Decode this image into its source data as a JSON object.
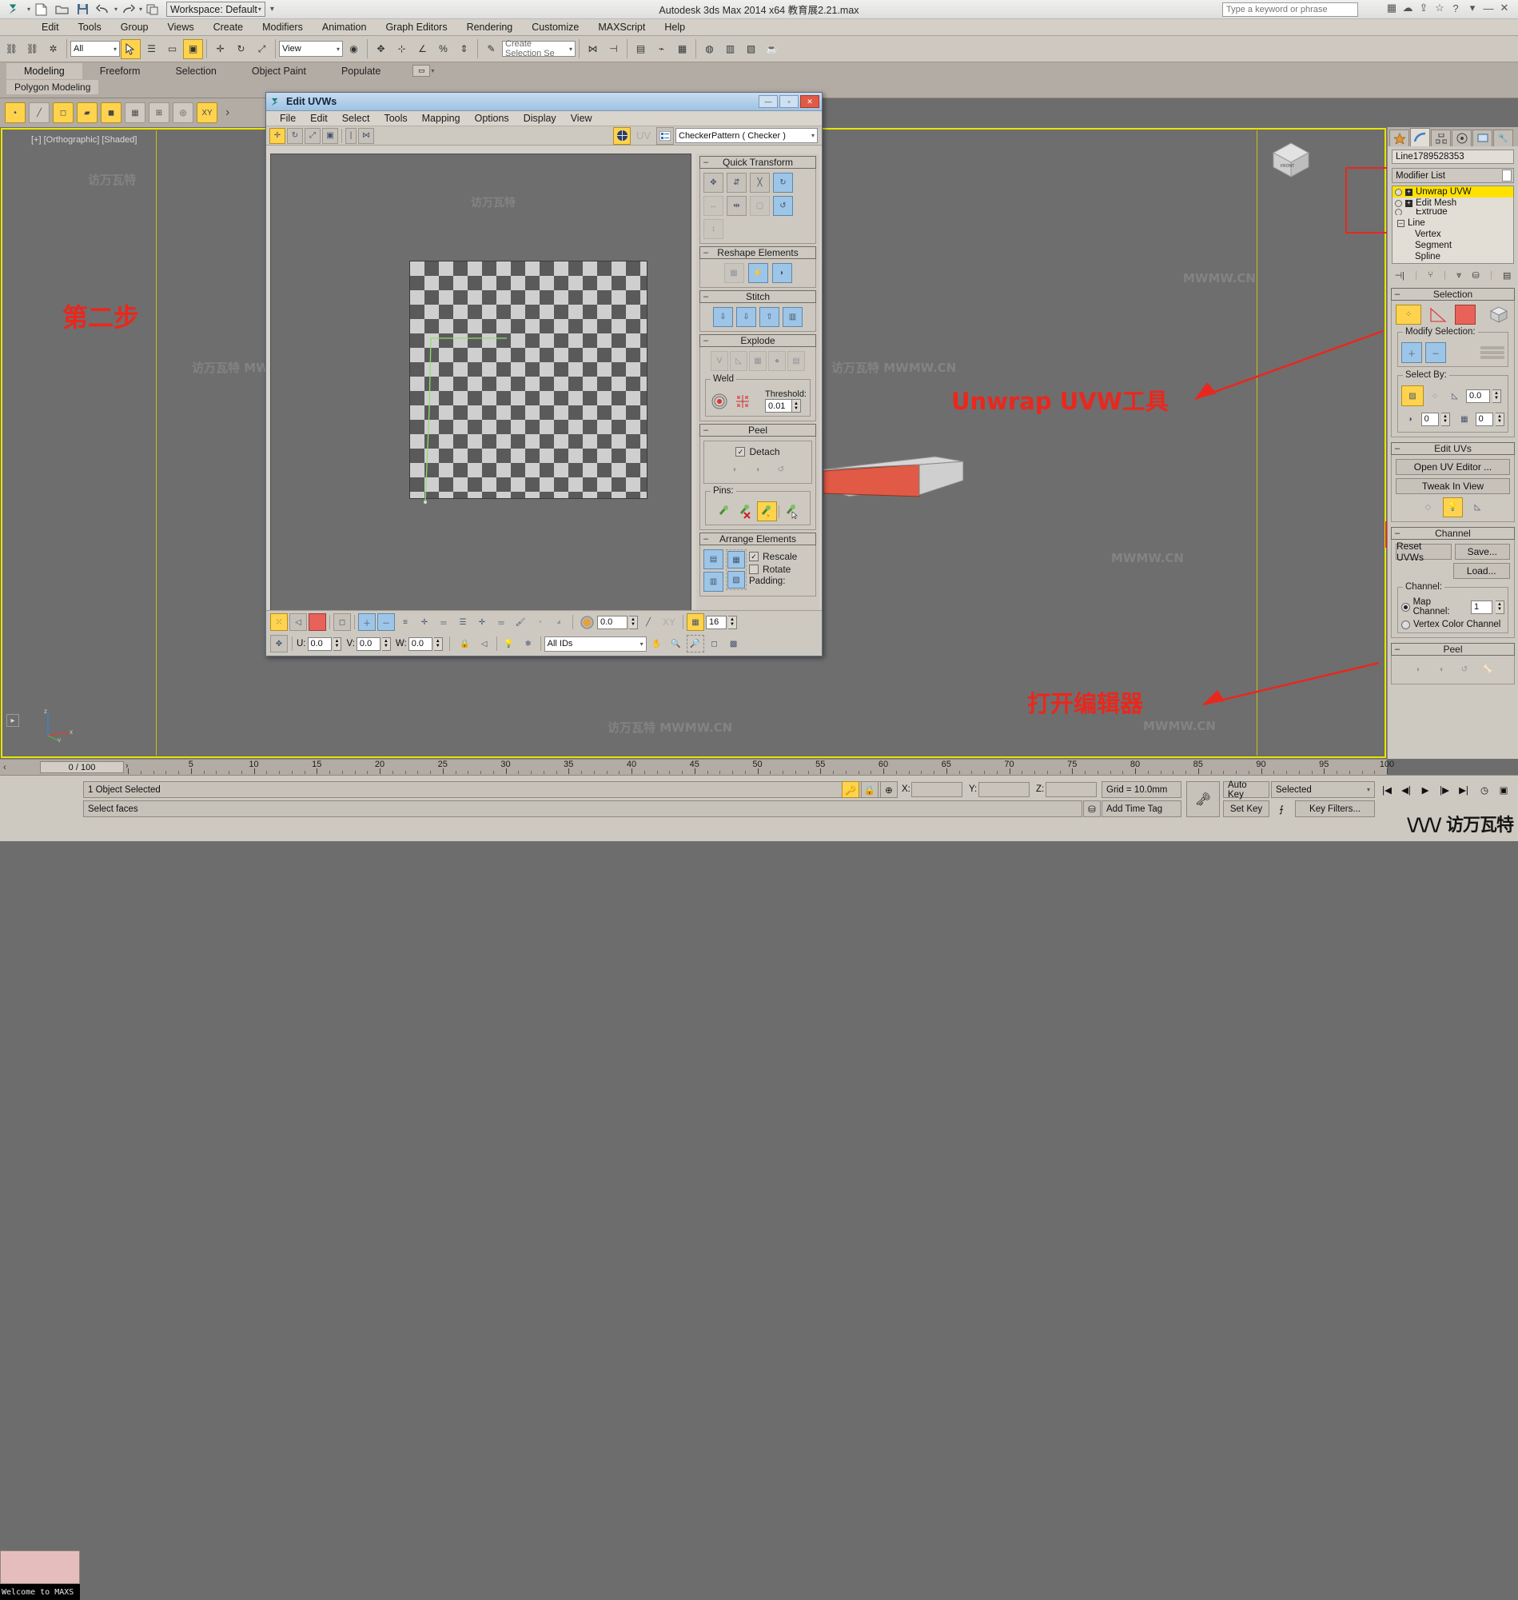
{
  "titlebar": {
    "app_title": "Autodesk 3ds Max  2014 x64      教育展2.21.max",
    "workspace_label": "Workspace: Default",
    "search_placeholder": "Type a keyword or phrase",
    "icons": [
      "new-file-icon",
      "open-file-icon",
      "save-icon",
      "undo-icon",
      "redo-icon",
      "project-folder-icon"
    ],
    "window_buttons": [
      "minimize",
      "restore",
      "close"
    ]
  },
  "menubar": {
    "items": [
      "Edit",
      "Tools",
      "Group",
      "Views",
      "Create",
      "Modifiers",
      "Animation",
      "Graph Editors",
      "Rendering",
      "Customize",
      "MAXScript",
      "Help"
    ]
  },
  "maintoolbar": {
    "selection_filter": "All",
    "reference_coord": "View",
    "named_selection_set": "Create Selection Se"
  },
  "ribbon": {
    "tabs": [
      "Modeling",
      "Freeform",
      "Selection",
      "Object Paint",
      "Populate"
    ],
    "active_tab": "Modeling",
    "subtab": "Polygon Modeling"
  },
  "viewport": {
    "label": "[+] [Orthographic] [Shaded]",
    "annotations": [
      {
        "text": "第二步",
        "id": "step-two"
      },
      {
        "text": "Unwrap UVW工具",
        "id": "unwrap-uvw-tool"
      },
      {
        "text": "打开编辑器",
        "id": "open-editor"
      }
    ],
    "watermarks": [
      "MWMW.CN",
      "MWMW.CN",
      "MWMW.CN",
      "MWMW.CN",
      "MWMW.CN",
      "MWMW.CN"
    ],
    "viewcube_label": "FRONT"
  },
  "uvw_dialog": {
    "title": "Edit UVWs",
    "menu": [
      "File",
      "Edit",
      "Select",
      "Tools",
      "Mapping",
      "Options",
      "Display",
      "View"
    ],
    "map_dropdown": "CheckerPattern  ( Checker )",
    "rollouts": [
      {
        "name": "Quick Transform",
        "collapsed": false
      },
      {
        "name": "Reshape Elements",
        "collapsed": false
      },
      {
        "name": "Stitch",
        "collapsed": false
      },
      {
        "name": "Explode",
        "collapsed": false
      },
      {
        "name": "Peel",
        "collapsed": false
      },
      {
        "name": "Arrange Elements",
        "collapsed": false
      }
    ],
    "weld": {
      "group_label": "Weld",
      "threshold_label": "Threshold:",
      "threshold_value": "0.01"
    },
    "peel": {
      "detach_label": "Detach",
      "detach_checked": true,
      "pins_label": "Pins:"
    },
    "arrange": {
      "rescale_label": "Rescale",
      "rescale_checked": true,
      "rotate_label": "Rotate",
      "rotate_checked": false,
      "padding_label": "Padding:"
    },
    "bottom": {
      "u_label": "U:",
      "u_value": "0.0",
      "v_label": "V:",
      "v_value": "0.0",
      "w_label": "W:",
      "w_value": "0.0",
      "ids_filter": "All IDs",
      "amount_value": "0.0",
      "grid_value": "16",
      "xy_label": "XY"
    }
  },
  "command_panel": {
    "tabs": [
      "create-tab",
      "modify-tab",
      "hierarchy-tab",
      "motion-tab",
      "display-tab",
      "utilities-tab"
    ],
    "active_tab": "modify-tab",
    "object_name": "Line1789528353",
    "modifier_list_label": "Modifier List",
    "modifier_stack": [
      {
        "name": "Unwrap UVW",
        "selected": true
      },
      {
        "name": "Edit Mesh",
        "selected": false
      },
      {
        "name": "Extrude",
        "selected": false
      }
    ],
    "base_object": "Line",
    "sub_objects": [
      "Vertex",
      "Segment",
      "Spline"
    ],
    "rollouts": {
      "selection": {
        "title": "Selection",
        "modify_selection_label": "Modify Selection:",
        "select_by_label": "Select By:",
        "angle_value": "0.0",
        "smoothing_value": "0",
        "matid_value": "0"
      },
      "edit_uvs": {
        "title": "Edit UVs",
        "open_uv_editor": "Open UV Editor ...",
        "tweak_in_view": "Tweak In View"
      },
      "channel": {
        "title": "Channel",
        "reset_uvws": "Reset UVWs",
        "save": "Save...",
        "load": "Load...",
        "group_label": "Channel:",
        "map_channel_label": "Map Channel:",
        "map_channel_value": "1",
        "map_channel_selected": true,
        "vertex_color_label": "Vertex Color Channel"
      },
      "peel": {
        "title": "Peel"
      }
    }
  },
  "timeline": {
    "frame_readout": "0 / 100",
    "ticks": [
      5,
      10,
      15,
      20,
      25,
      30,
      35,
      40,
      45,
      50,
      55,
      60,
      65,
      70,
      75,
      80,
      85,
      90,
      95,
      100
    ]
  },
  "statusbar": {
    "object_selected": "1 Object Selected",
    "prompt": "Select faces",
    "maxlisten_text": "Welcome to MAXS",
    "x_label": "X:",
    "x_value": "",
    "y_label": "Y:",
    "y_value": "",
    "z_label": "Z:",
    "z_value": "",
    "grid_text": "Grid = 10.0mm",
    "add_time_tag": "Add Time Tag",
    "auto_key": "Auto Key",
    "set_key": "Set Key",
    "key_filters": "Key Filters...",
    "key_mode": "Selected",
    "watermark": "访万瓦特"
  },
  "colors": {
    "accent_yellow": "#ffe200",
    "annotation_red": "#e8281e",
    "panel_gray": "#cdc9c1",
    "viewport_gray": "#6e6e6e",
    "dialog_title_blue": "#9ec2e4"
  }
}
